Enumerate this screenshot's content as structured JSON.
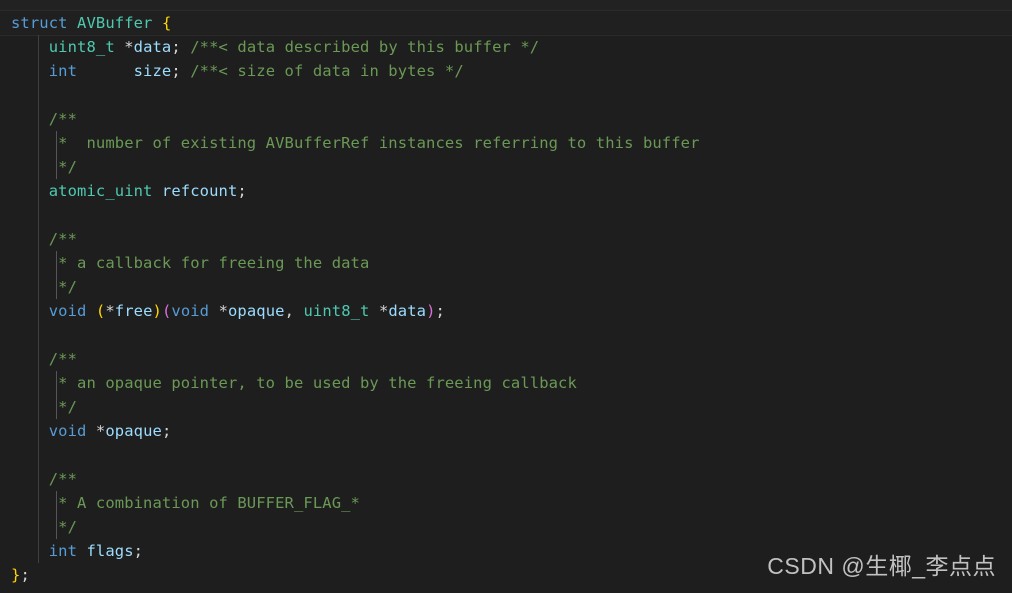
{
  "editor": {
    "background": "#1e1e1e",
    "language": "c",
    "font_size_px": 15.5,
    "line_height_px": 24
  },
  "theme": {
    "background": "#1e1e1e",
    "active_line": "#202020",
    "foreground": "#d4d4d4",
    "keyword": "#569cd6",
    "type": "#4ec9b0",
    "variable": "#9cdcfe",
    "comment": "#6a9955",
    "bracket_level1": "#ffd700",
    "bracket_level2": "#da70d6",
    "indent_guide": "#404040",
    "comment_guide": "#565656"
  },
  "code": {
    "lines": [
      {
        "n": 1,
        "indent": 0,
        "guides": [],
        "tokens": [
          {
            "t": "struct",
            "c": "kw"
          },
          {
            "t": " ",
            "c": "punct"
          },
          {
            "t": "AVBuffer",
            "c": "type"
          },
          {
            "t": " ",
            "c": "punct"
          },
          {
            "t": "{",
            "c": "brace1"
          }
        ]
      },
      {
        "n": 2,
        "indent": 1,
        "guides": [
          "level1"
        ],
        "tokens": [
          {
            "t": "    ",
            "c": "punct"
          },
          {
            "t": "uint8_t",
            "c": "type"
          },
          {
            "t": " ",
            "c": "punct"
          },
          {
            "t": "*",
            "c": "punct"
          },
          {
            "t": "data",
            "c": "var"
          },
          {
            "t": "; ",
            "c": "punct"
          },
          {
            "t": "/**< data described by this buffer */",
            "c": "cmt"
          }
        ]
      },
      {
        "n": 3,
        "indent": 1,
        "guides": [
          "level1"
        ],
        "tokens": [
          {
            "t": "    ",
            "c": "punct"
          },
          {
            "t": "int",
            "c": "kw"
          },
          {
            "t": "      ",
            "c": "punct"
          },
          {
            "t": "size",
            "c": "var"
          },
          {
            "t": "; ",
            "c": "punct"
          },
          {
            "t": "/**< size of data in bytes */",
            "c": "cmt"
          }
        ]
      },
      {
        "n": 4,
        "indent": 1,
        "guides": [
          "level1"
        ],
        "tokens": []
      },
      {
        "n": 5,
        "indent": 1,
        "guides": [
          "level1"
        ],
        "tokens": [
          {
            "t": "    ",
            "c": "punct"
          },
          {
            "t": "/**",
            "c": "cmt"
          }
        ]
      },
      {
        "n": 6,
        "indent": 1,
        "guides": [
          "level1",
          "comment"
        ],
        "tokens": [
          {
            "t": "     ",
            "c": "punct"
          },
          {
            "t": "*  number of existing AVBufferRef instances referring to this buffer",
            "c": "cmt"
          }
        ]
      },
      {
        "n": 7,
        "indent": 1,
        "guides": [
          "level1",
          "comment"
        ],
        "tokens": [
          {
            "t": "     ",
            "c": "punct"
          },
          {
            "t": "*/",
            "c": "cmt"
          }
        ]
      },
      {
        "n": 8,
        "indent": 1,
        "guides": [
          "level1"
        ],
        "tokens": [
          {
            "t": "    ",
            "c": "punct"
          },
          {
            "t": "atomic_uint",
            "c": "type"
          },
          {
            "t": " ",
            "c": "punct"
          },
          {
            "t": "refcount",
            "c": "var"
          },
          {
            "t": ";",
            "c": "punct"
          }
        ]
      },
      {
        "n": 9,
        "indent": 1,
        "guides": [
          "level1"
        ],
        "tokens": []
      },
      {
        "n": 10,
        "indent": 1,
        "guides": [
          "level1"
        ],
        "tokens": [
          {
            "t": "    ",
            "c": "punct"
          },
          {
            "t": "/**",
            "c": "cmt"
          }
        ]
      },
      {
        "n": 11,
        "indent": 1,
        "guides": [
          "level1",
          "comment"
        ],
        "tokens": [
          {
            "t": "     ",
            "c": "punct"
          },
          {
            "t": "* a callback for freeing the data",
            "c": "cmt"
          }
        ]
      },
      {
        "n": 12,
        "indent": 1,
        "guides": [
          "level1",
          "comment"
        ],
        "tokens": [
          {
            "t": "     ",
            "c": "punct"
          },
          {
            "t": "*/",
            "c": "cmt"
          }
        ]
      },
      {
        "n": 13,
        "indent": 1,
        "guides": [
          "level1"
        ],
        "tokens": [
          {
            "t": "    ",
            "c": "punct"
          },
          {
            "t": "void",
            "c": "kw"
          },
          {
            "t": " ",
            "c": "punct"
          },
          {
            "t": "(",
            "c": "brace1"
          },
          {
            "t": "*",
            "c": "punct"
          },
          {
            "t": "free",
            "c": "fn"
          },
          {
            "t": ")",
            "c": "brace1"
          },
          {
            "t": "(",
            "c": "brace2"
          },
          {
            "t": "void",
            "c": "kw"
          },
          {
            "t": " ",
            "c": "punct"
          },
          {
            "t": "*",
            "c": "punct"
          },
          {
            "t": "opaque",
            "c": "var"
          },
          {
            "t": ", ",
            "c": "punct"
          },
          {
            "t": "uint8_t",
            "c": "type"
          },
          {
            "t": " ",
            "c": "punct"
          },
          {
            "t": "*",
            "c": "punct"
          },
          {
            "t": "data",
            "c": "var"
          },
          {
            "t": ")",
            "c": "brace2"
          },
          {
            "t": ";",
            "c": "punct"
          }
        ]
      },
      {
        "n": 14,
        "indent": 1,
        "guides": [
          "level1"
        ],
        "tokens": []
      },
      {
        "n": 15,
        "indent": 1,
        "guides": [
          "level1"
        ],
        "tokens": [
          {
            "t": "    ",
            "c": "punct"
          },
          {
            "t": "/**",
            "c": "cmt"
          }
        ]
      },
      {
        "n": 16,
        "indent": 1,
        "guides": [
          "level1",
          "comment"
        ],
        "tokens": [
          {
            "t": "     ",
            "c": "punct"
          },
          {
            "t": "* an opaque pointer, to be used by the freeing callback",
            "c": "cmt"
          }
        ]
      },
      {
        "n": 17,
        "indent": 1,
        "guides": [
          "level1",
          "comment"
        ],
        "tokens": [
          {
            "t": "     ",
            "c": "punct"
          },
          {
            "t": "*/",
            "c": "cmt"
          }
        ]
      },
      {
        "n": 18,
        "indent": 1,
        "guides": [
          "level1"
        ],
        "tokens": [
          {
            "t": "    ",
            "c": "punct"
          },
          {
            "t": "void",
            "c": "kw"
          },
          {
            "t": " ",
            "c": "punct"
          },
          {
            "t": "*",
            "c": "punct"
          },
          {
            "t": "opaque",
            "c": "var"
          },
          {
            "t": ";",
            "c": "punct"
          }
        ]
      },
      {
        "n": 19,
        "indent": 1,
        "guides": [
          "level1"
        ],
        "tokens": []
      },
      {
        "n": 20,
        "indent": 1,
        "guides": [
          "level1"
        ],
        "tokens": [
          {
            "t": "    ",
            "c": "punct"
          },
          {
            "t": "/**",
            "c": "cmt"
          }
        ]
      },
      {
        "n": 21,
        "indent": 1,
        "guides": [
          "level1",
          "comment"
        ],
        "tokens": [
          {
            "t": "     ",
            "c": "punct"
          },
          {
            "t": "* A combination of BUFFER_FLAG_*",
            "c": "cmt"
          }
        ]
      },
      {
        "n": 22,
        "indent": 1,
        "guides": [
          "level1",
          "comment"
        ],
        "tokens": [
          {
            "t": "     ",
            "c": "punct"
          },
          {
            "t": "*/",
            "c": "cmt"
          }
        ]
      },
      {
        "n": 23,
        "indent": 1,
        "guides": [
          "level1"
        ],
        "tokens": [
          {
            "t": "    ",
            "c": "punct"
          },
          {
            "t": "int",
            "c": "kw"
          },
          {
            "t": " ",
            "c": "punct"
          },
          {
            "t": "flags",
            "c": "var"
          },
          {
            "t": ";",
            "c": "punct"
          }
        ]
      },
      {
        "n": 24,
        "indent": 0,
        "guides": [],
        "tokens": [
          {
            "t": "}",
            "c": "brace1"
          },
          {
            "t": ";",
            "c": "punct"
          }
        ]
      }
    ]
  },
  "watermark": {
    "text": "CSDN @生椰_李点点"
  }
}
